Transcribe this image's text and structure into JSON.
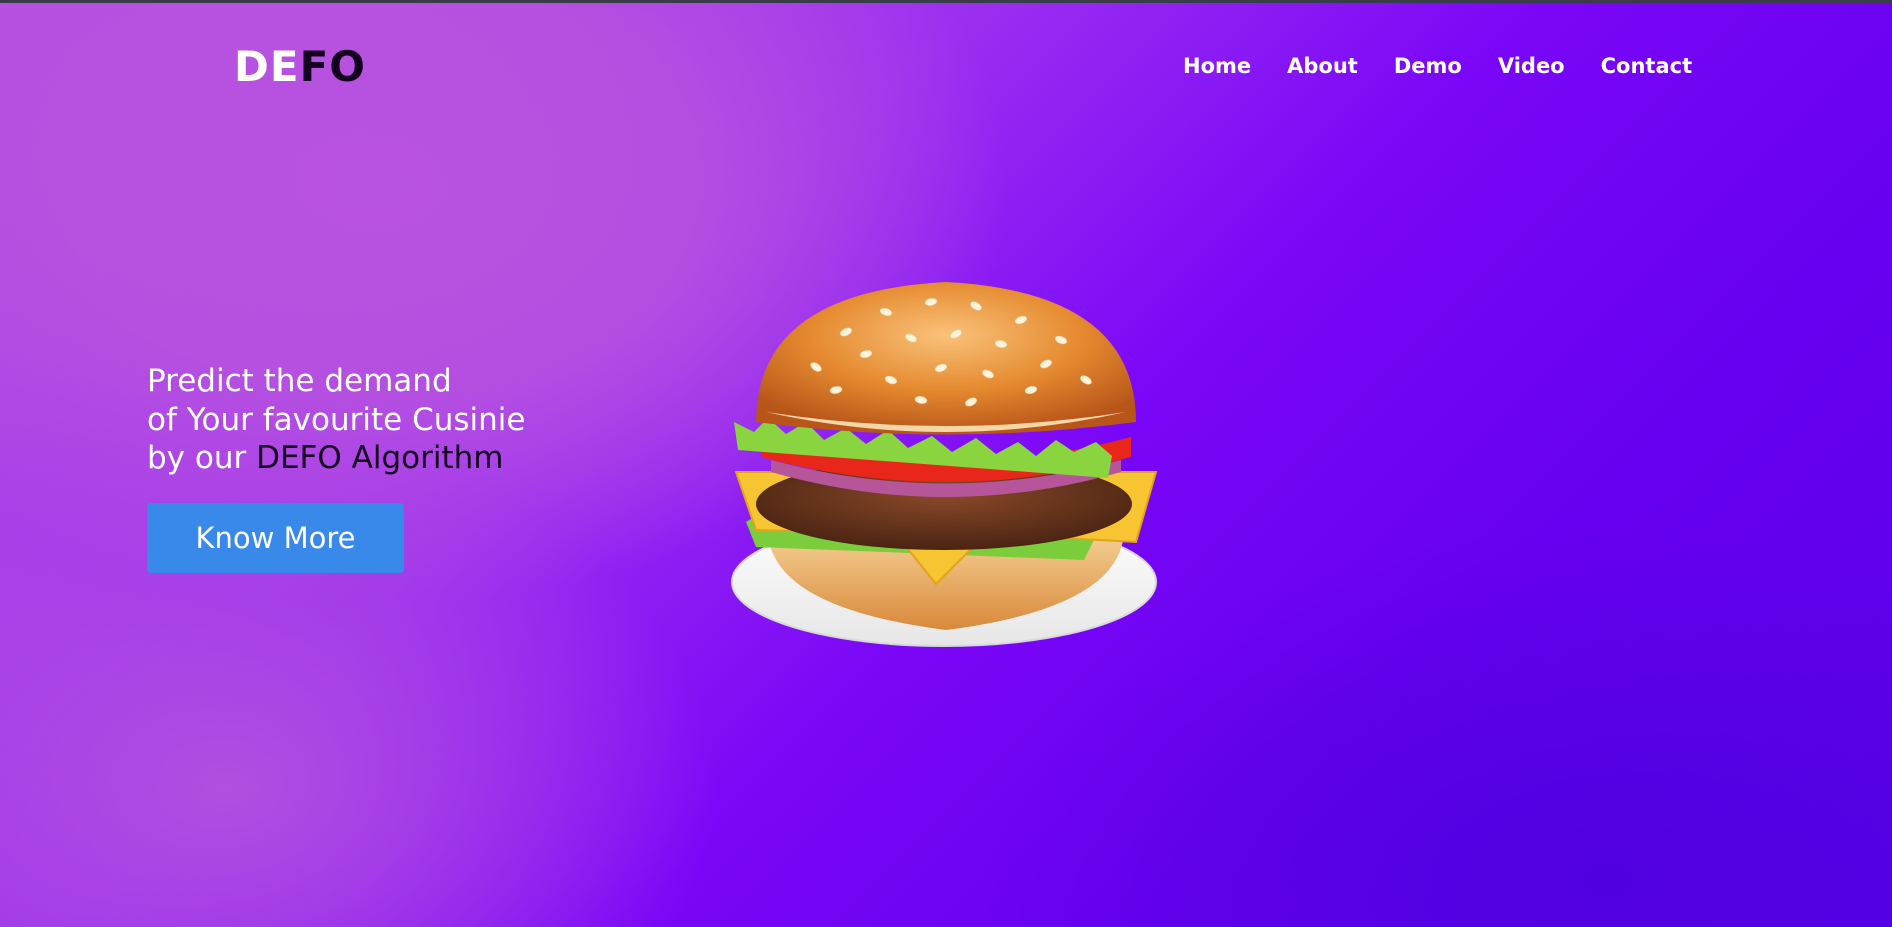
{
  "brand": {
    "part1": "DE",
    "part2": "FO"
  },
  "nav": {
    "items": [
      {
        "label": "Home"
      },
      {
        "label": "About"
      },
      {
        "label": "Demo"
      },
      {
        "label": "Video"
      },
      {
        "label": "Contact"
      }
    ]
  },
  "hero": {
    "line1": "Predict the demand",
    "line2": "of Your favourite Cusinie",
    "line3_prefix": "by our ",
    "line3_highlight": "DEFO Algorithm",
    "button_label": "Know More"
  },
  "illustration": {
    "icon": "burger-illustration"
  },
  "colors": {
    "button": "#3989eb",
    "accent_dark": "#14001f",
    "gradient_start": "#b853df",
    "gradient_end": "#5a00e8"
  }
}
